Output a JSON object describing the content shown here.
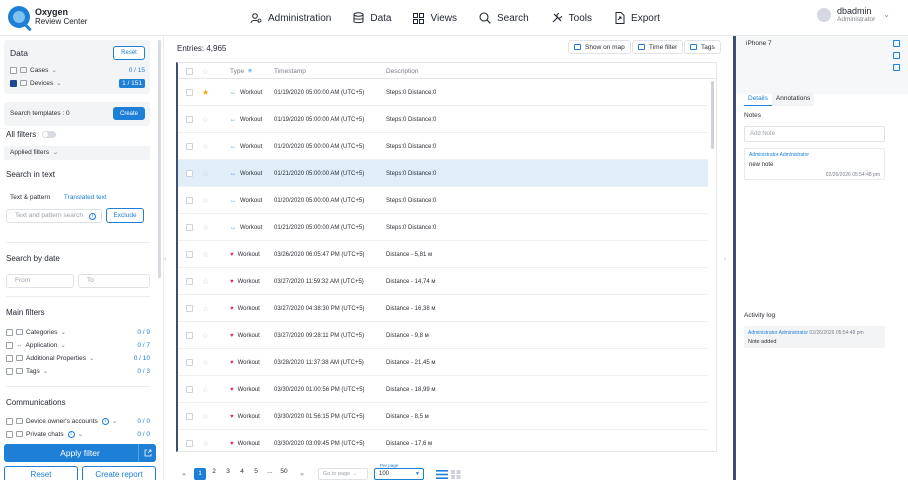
{
  "app": {
    "name_line1": "Oxygen",
    "name_line2": "Review Center"
  },
  "nav": [
    {
      "label": "Administration",
      "icon": "users-cog-icon"
    },
    {
      "label": "Data",
      "icon": "database-icon"
    },
    {
      "label": "Views",
      "icon": "grid-icon"
    },
    {
      "label": "Search",
      "icon": "search-icon"
    },
    {
      "label": "Tools",
      "icon": "tools-icon"
    },
    {
      "label": "Export",
      "icon": "export-icon"
    }
  ],
  "user": {
    "name": "dbadmin",
    "role": "Administrator"
  },
  "sidebar": {
    "data_title": "Data",
    "reset_label": "Reset",
    "cases": {
      "label": "Cases",
      "count": "0 / 15"
    },
    "devices": {
      "label": "Devices",
      "count": "1 / 151"
    },
    "search_templates": "Search templates : 0",
    "create_label": "Create",
    "all_filters": "All filters",
    "applied_filters": "Applied filters",
    "search_in_text": "Search in text",
    "tab_text_pattern": "Text & pattern",
    "tab_translated": "Translated text",
    "text_search_placeholder": "Text and pattern search",
    "exclude_label": "Exclude",
    "search_by_date": "Search by date",
    "from_placeholder": "From",
    "to_placeholder": "To",
    "main_filters": "Main filters",
    "filters": [
      {
        "label": "Categories",
        "count": "0 / 9"
      },
      {
        "label": "Application",
        "count": "0 / 7"
      },
      {
        "label": "Additional Properties",
        "count": "0 / 10"
      },
      {
        "label": "Tags",
        "count": "0 / 3"
      }
    ],
    "communications": "Communications",
    "comm_filters": [
      {
        "label": "Device owner's accounts",
        "count": "0 / 0"
      },
      {
        "label": "Private chats",
        "count": "0 / 0"
      }
    ],
    "apply_filter": "Apply filter",
    "reset_bottom": "Reset",
    "create_report": "Create report"
  },
  "main": {
    "entries": "Entries: 4,965",
    "show_on_map": "Show on map",
    "time_filter": "Time filter",
    "tags": "Tags",
    "columns": {
      "type": "Type",
      "timestamp": "Timestamp",
      "description": "Description"
    },
    "rows": [
      {
        "type": "Workout",
        "icon": "workout",
        "timestamp": "01/19/2020 05:00:00 AM (UTC+5)",
        "description": "Steps:0 Distance:0",
        "starred": true,
        "selected": false
      },
      {
        "type": "Workout",
        "icon": "workout",
        "timestamp": "01/19/2020 05:00:00 AM (UTC+5)",
        "description": "Steps:0 Distance:0",
        "starred": false,
        "selected": false
      },
      {
        "type": "Workout",
        "icon": "workout",
        "timestamp": "01/20/2020 05:00:00 AM (UTC+5)",
        "description": "Steps:0 Distance:0",
        "starred": false,
        "selected": false
      },
      {
        "type": "Workout",
        "icon": "workout",
        "timestamp": "01/21/2020 05:00:00 AM (UTC+5)",
        "description": "Steps:0 Distance:0",
        "starred": false,
        "selected": true
      },
      {
        "type": "Workout",
        "icon": "workout",
        "timestamp": "01/20/2020 05:00:00 AM (UTC+5)",
        "description": "Steps:0 Distance:0",
        "starred": false,
        "selected": false
      },
      {
        "type": "Workout",
        "icon": "workout",
        "timestamp": "01/21/2020 05:00:00 AM (UTC+5)",
        "description": "Steps:0 Distance:0",
        "starred": false,
        "selected": false
      },
      {
        "type": "Workout",
        "icon": "heart",
        "timestamp": "03/26/2020 06:05:47 PM (UTC+5)",
        "description": "Distance - 5,81 м",
        "starred": false,
        "selected": false
      },
      {
        "type": "Workout",
        "icon": "heart",
        "timestamp": "03/27/2020 11:59:32 AM (UTC+5)",
        "description": "Distance - 14,74 м",
        "starred": false,
        "selected": false
      },
      {
        "type": "Workout",
        "icon": "heart",
        "timestamp": "03/27/2020 04:38:30 PM (UTC+5)",
        "description": "Distance - 16,38 м",
        "starred": false,
        "selected": false
      },
      {
        "type": "Workout",
        "icon": "heart",
        "timestamp": "03/27/2020 09:28:11 PM (UTC+5)",
        "description": "Distance - 9,8 м",
        "starred": false,
        "selected": false
      },
      {
        "type": "Workout",
        "icon": "heart",
        "timestamp": "03/28/2020 11:37:38 AM (UTC+5)",
        "description": "Distance - 21,45 м",
        "starred": false,
        "selected": false
      },
      {
        "type": "Workout",
        "icon": "heart",
        "timestamp": "03/30/2020 01:00:56 PM (UTC+5)",
        "description": "Distance - 18,99 м",
        "starred": false,
        "selected": false
      },
      {
        "type": "Workout",
        "icon": "heart",
        "timestamp": "03/30/2020 01:56:15 PM (UTC+5)",
        "description": "Distance - 8,5 м",
        "starred": false,
        "selected": false
      },
      {
        "type": "Workout",
        "icon": "heart",
        "timestamp": "03/30/2020 03:09:45 PM (UTC+5)",
        "description": "Distance - 17,6 м",
        "starred": false,
        "selected": false
      }
    ],
    "pager": {
      "prev": "«",
      "pages": [
        "1",
        "2",
        "3",
        "4",
        "5",
        "...",
        "50"
      ],
      "current": "1",
      "next": "»",
      "goto_placeholder": "Go to page →",
      "per_page_label": "Per page",
      "per_page_value": "100"
    }
  },
  "details": {
    "title": "iPhone 7",
    "tab_details": "Details",
    "tab_annotations": "Annotations",
    "notes_label": "Notes",
    "add_note_placeholder": "Add Note",
    "note": {
      "author": "Administrator Administrator",
      "text": "new note",
      "date": "02/26/2026 05:54:48 pm"
    },
    "activity_label": "Activity log",
    "activity": {
      "author": "Administrator Administrator",
      "date": "02/26/2026 05:54:48 pm",
      "text": "Note added"
    }
  },
  "colors": {
    "accent": "#1d7fd6",
    "selected_row": "#e1edf9",
    "star": "#f3a712",
    "heart": "#e0245e"
  }
}
